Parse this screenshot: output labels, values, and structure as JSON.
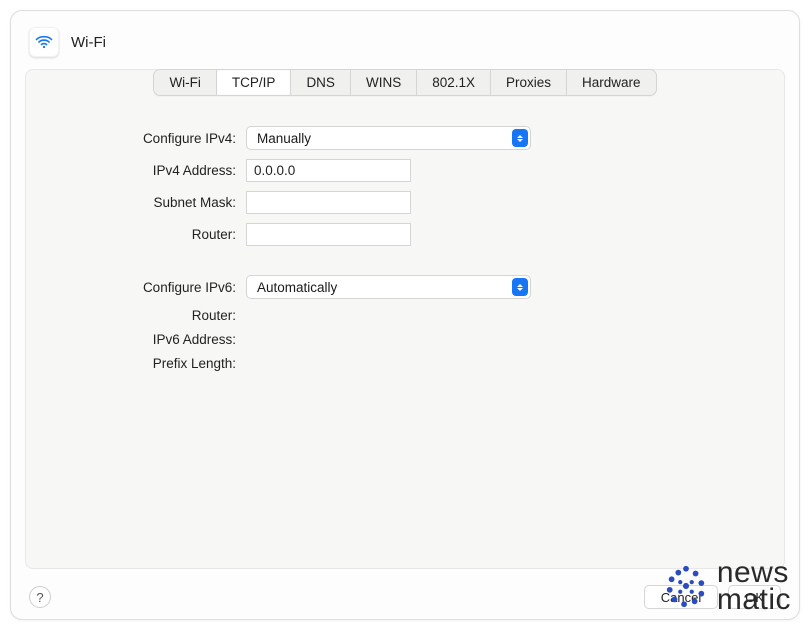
{
  "header": {
    "title": "Wi-Fi"
  },
  "tabs": {
    "wifi": "Wi-Fi",
    "tcpip": "TCP/IP",
    "dns": "DNS",
    "wins": "WINS",
    "8021x": "802.1X",
    "proxies": "Proxies",
    "hardware": "Hardware",
    "active": "tcpip"
  },
  "form": {
    "configure_ipv4_label": "Configure IPv4:",
    "configure_ipv4_value": "Manually",
    "ipv4_address_label": "IPv4 Address:",
    "ipv4_address_value": "0.0.0.0",
    "subnet_mask_label": "Subnet Mask:",
    "subnet_mask_value": "",
    "router_label": "Router:",
    "router_value": "",
    "configure_ipv6_label": "Configure IPv6:",
    "configure_ipv6_value": "Automatically",
    "ipv6_router_label": "Router:",
    "ipv6_router_value": "",
    "ipv6_address_label": "IPv6 Address:",
    "ipv6_address_value": "",
    "prefix_length_label": "Prefix Length:",
    "prefix_length_value": ""
  },
  "footer": {
    "help": "?",
    "cancel": "Cancel",
    "ok": "OK"
  },
  "watermark": {
    "line1": "news",
    "line2": "matic"
  },
  "colors": {
    "accent": "#1676f3"
  }
}
